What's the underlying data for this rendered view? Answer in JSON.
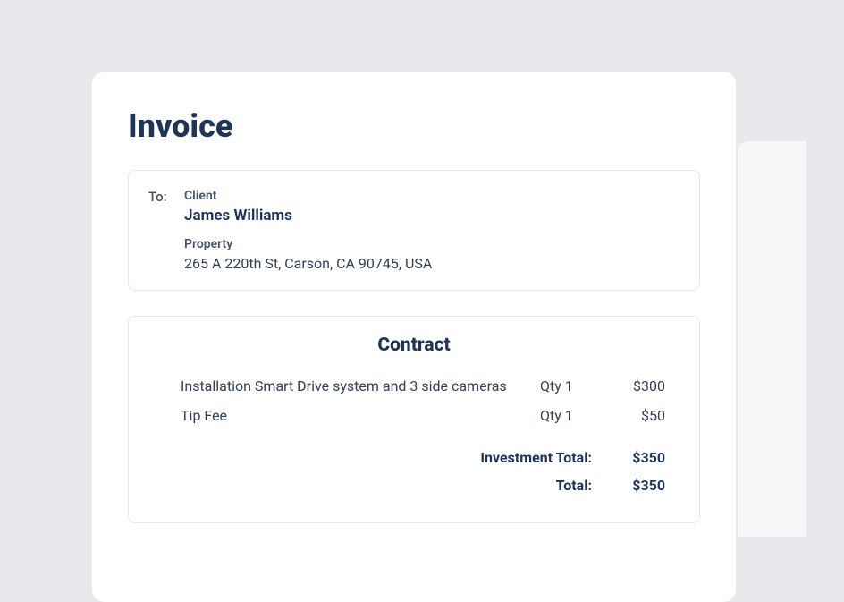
{
  "page": {
    "title": "Invoice"
  },
  "recipient": {
    "to_label": "To:",
    "client_label": "Client",
    "client_name": "James Williams",
    "property_label": "Property",
    "property_address": "265 A 220th St, Carson, CA 90745, USA"
  },
  "contract": {
    "title": "Contract",
    "items": [
      {
        "description": "Installation Smart Drive system and 3 side cameras",
        "qty": "Qty 1",
        "price": "$300"
      },
      {
        "description": "Tip Fee",
        "qty": "Qty 1",
        "price": "$50"
      }
    ],
    "totals": {
      "investment_label": "Investment Total:",
      "investment_value": "$350",
      "total_label": "Total:",
      "total_value": "$350"
    }
  }
}
